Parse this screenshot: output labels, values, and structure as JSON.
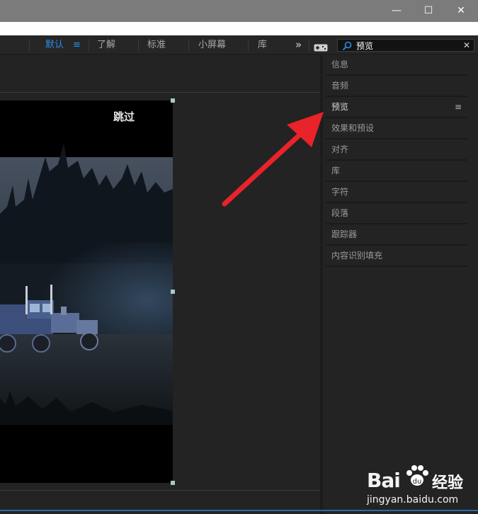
{
  "window": {
    "minimize_icon": "minimize-icon",
    "maximize_icon": "maximize-icon",
    "close_icon": "close-icon",
    "minimize_glyph": "—",
    "maximize_glyph": "☐",
    "close_glyph": "✕"
  },
  "workspaces": {
    "items": [
      "默认",
      "了解",
      "标准",
      "小屏幕",
      "库"
    ],
    "active_index": 0,
    "menu_glyph": "≡",
    "overflow_glyph": "»",
    "active_color": "#2d8ceb"
  },
  "search": {
    "value": "预览",
    "clear_glyph": "✕"
  },
  "composition": {
    "skip_label": "跳过"
  },
  "panels": {
    "items": [
      {
        "label": "信息"
      },
      {
        "label": "音频"
      },
      {
        "label": "预览",
        "active": true,
        "menu_glyph": "≡"
      },
      {
        "label": "效果和预设"
      },
      {
        "label": "对齐"
      },
      {
        "label": "库"
      },
      {
        "label": "字符"
      },
      {
        "label": "段落"
      },
      {
        "label": "跟踪器"
      },
      {
        "label": "内容识别填充"
      }
    ]
  },
  "annotation": {
    "arrow_color": "#e8232a"
  },
  "watermark": {
    "logo": "Bai",
    "logo_suffix": "经验",
    "url": "jingyan.baidu.com"
  }
}
